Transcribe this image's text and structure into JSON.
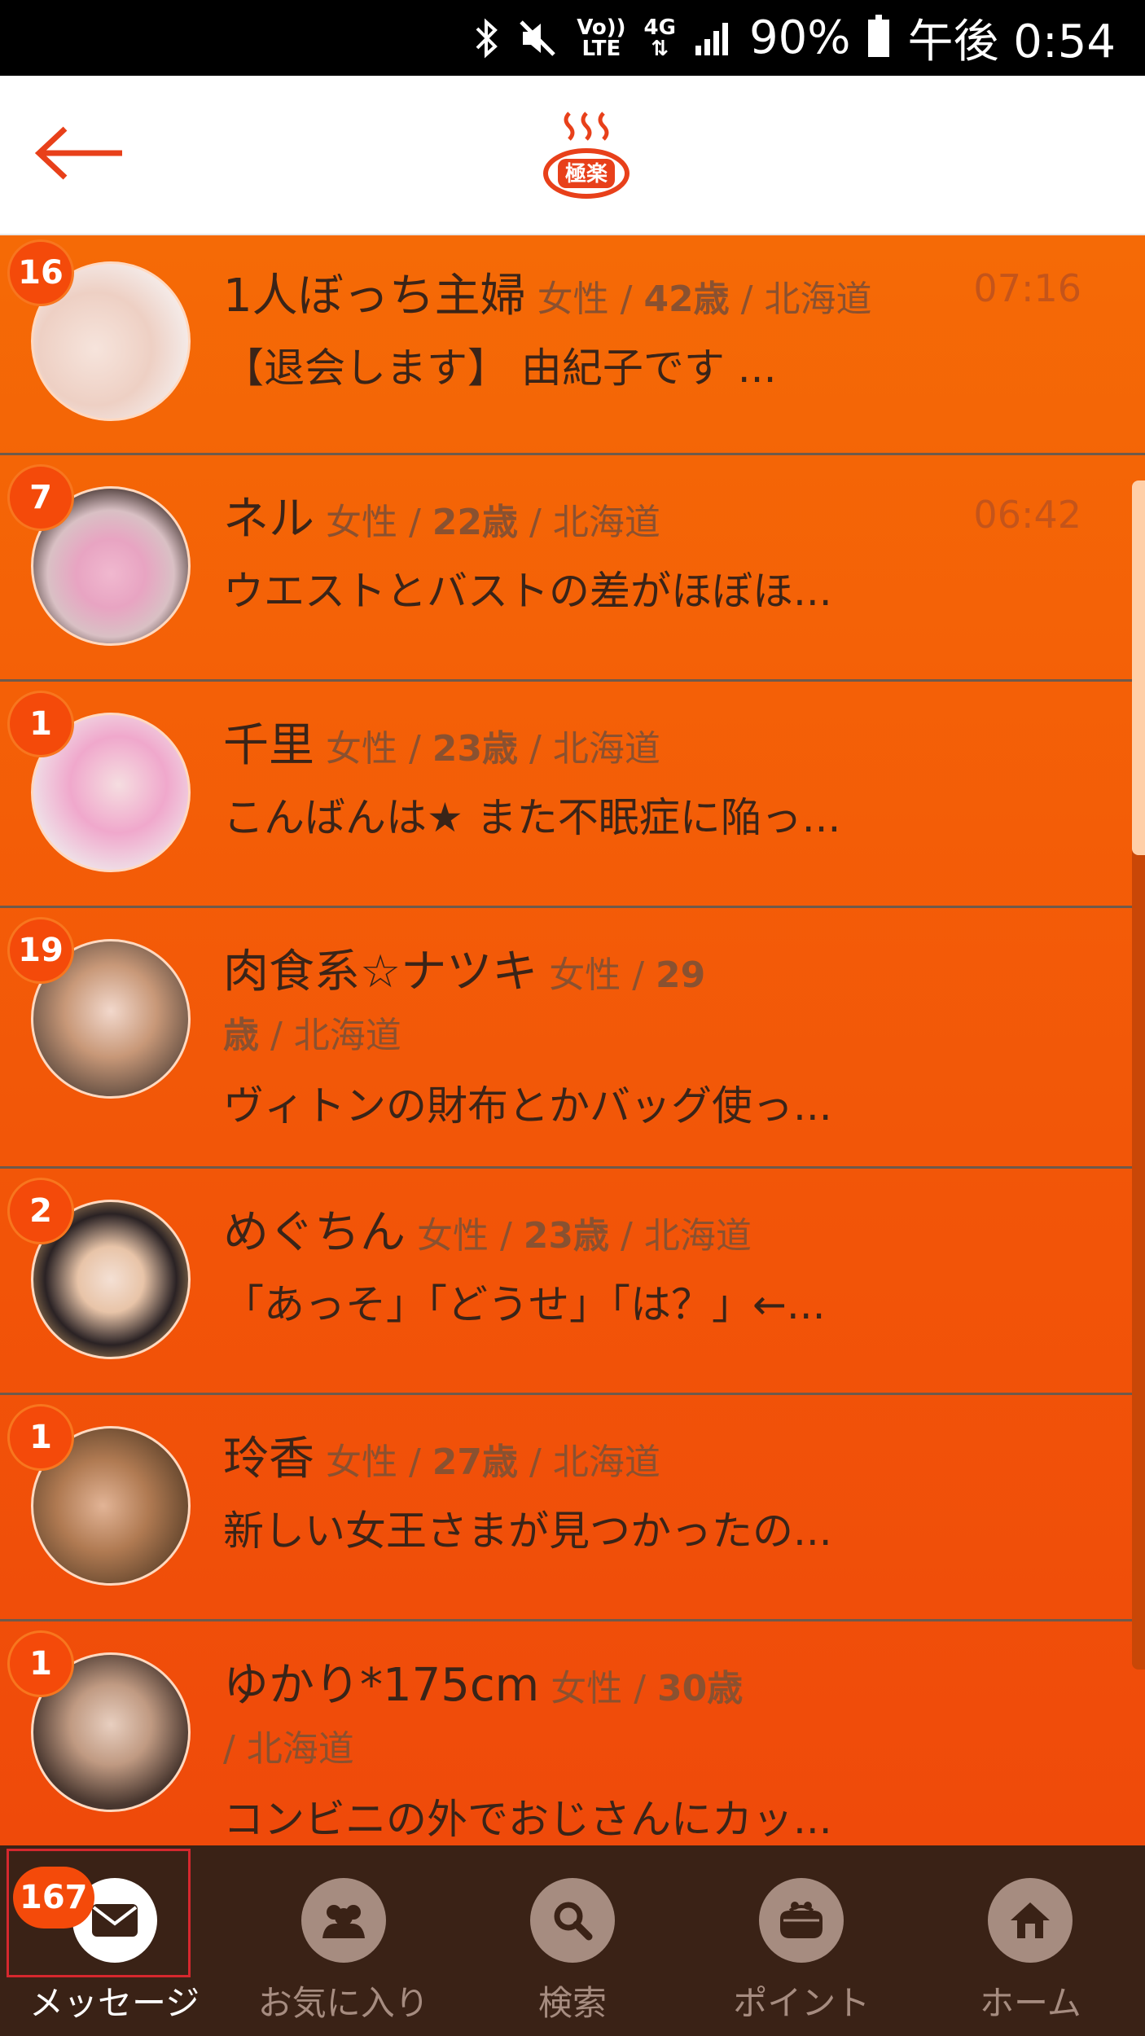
{
  "status_bar": {
    "volte_top": "Vo))",
    "volte_bottom": "LTE",
    "network": "4G",
    "battery": "90%",
    "time": "午後 0:54"
  },
  "header": {
    "logo_text": "極楽",
    "back_icon": "arrow-left-icon",
    "colors": {
      "accent": "#e8401a"
    }
  },
  "conversations": [
    {
      "badge": "16",
      "name": "1人ぼっち主婦",
      "gender": "女性",
      "age": "42歳",
      "region": "北海道",
      "time": "07:16",
      "message": "【退会します】 由紀子です ..."
    },
    {
      "badge": "7",
      "name": "ネル",
      "gender": "女性",
      "age": "22歳",
      "region": "北海道",
      "time": "06:42",
      "message": "ウエストとバストの差がほぼほ..."
    },
    {
      "badge": "1",
      "name": "千里",
      "gender": "女性",
      "age": "23歳",
      "region": "北海道",
      "time": "",
      "message": "こんばんは★ また不眠症に陥っ..."
    },
    {
      "badge": "19",
      "name": "肉食系☆ナツキ",
      "gender": "女性",
      "age": "29歳",
      "region": "北海道",
      "time": "",
      "message": "ヴィトンの財布とかバッグ使っ..."
    },
    {
      "badge": "2",
      "name": "めぐちん",
      "gender": "女性",
      "age": "23歳",
      "region": "北海道",
      "time": "",
      "message": "「あっそ」「どうせ」「は？」←..."
    },
    {
      "badge": "1",
      "name": "玲香",
      "gender": "女性",
      "age": "27歳",
      "region": "北海道",
      "time": "",
      "message": "新しい女王さまが見つかったの..."
    },
    {
      "badge": "1",
      "name": "ゆかり*175cm",
      "gender": "女性",
      "age": "30歳",
      "region": "北海道",
      "time": "",
      "message": "コンビニの外でおじさんにカッ..."
    }
  ],
  "bottom_nav": {
    "messages": {
      "label": "メッセージ",
      "badge": "167",
      "icon": "envelope-icon"
    },
    "favorites": {
      "label": "お気に入り",
      "icon": "users-icon"
    },
    "search": {
      "label": "検索",
      "icon": "search-icon"
    },
    "points": {
      "label": "ポイント",
      "icon": "wallet-icon"
    },
    "home": {
      "label": "ホーム",
      "icon": "home-icon"
    }
  }
}
